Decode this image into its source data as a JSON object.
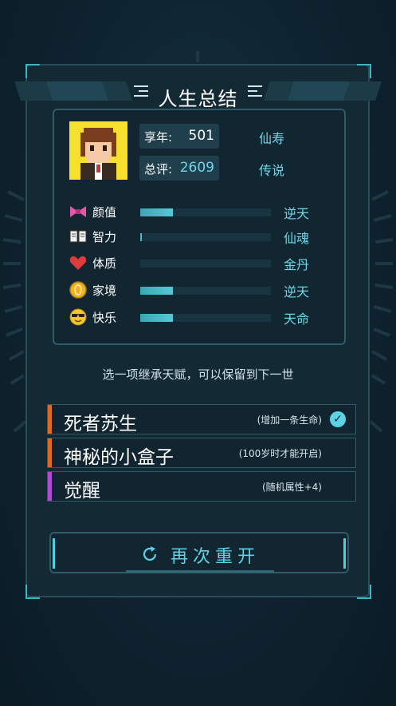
{
  "title": "人生总结",
  "summary": {
    "age": {
      "label": "享年:",
      "value": "501",
      "grade": "仙寿"
    },
    "score": {
      "label": "总评:",
      "value": "2609",
      "grade": "传说"
    }
  },
  "attributes": [
    {
      "label": "颜值",
      "grade": "逆天",
      "level": 0.25,
      "icon": "bow-icon"
    },
    {
      "label": "智力",
      "grade": "仙魂",
      "level": 0.01,
      "icon": "book-icon"
    },
    {
      "label": "体质",
      "grade": "金丹",
      "level": 0.0,
      "icon": "heart-icon"
    },
    {
      "label": "家境",
      "grade": "逆天",
      "level": 0.25,
      "icon": "coin-icon"
    },
    {
      "label": "快乐",
      "grade": "天命",
      "level": 0.25,
      "icon": "sunglasses-face-icon"
    }
  ],
  "hint": "选一项继承天赋，可以保留到下一世",
  "talents": [
    {
      "name": "死者苏生",
      "desc": "(增加一条生命)",
      "accent": "#e06a1f",
      "selected": true
    },
    {
      "name": "神秘的小盒子",
      "desc": "(100岁时才能开启)",
      "accent": "#e06a1f",
      "selected": false
    },
    {
      "name": "觉醒",
      "desc": "(随机属性+4)",
      "accent": "#b04ad8",
      "selected": false
    }
  ],
  "restart_label": "再次重开",
  "colors": {
    "accent": "#5fd3e6",
    "avatar_bg": "#f6df2d"
  }
}
